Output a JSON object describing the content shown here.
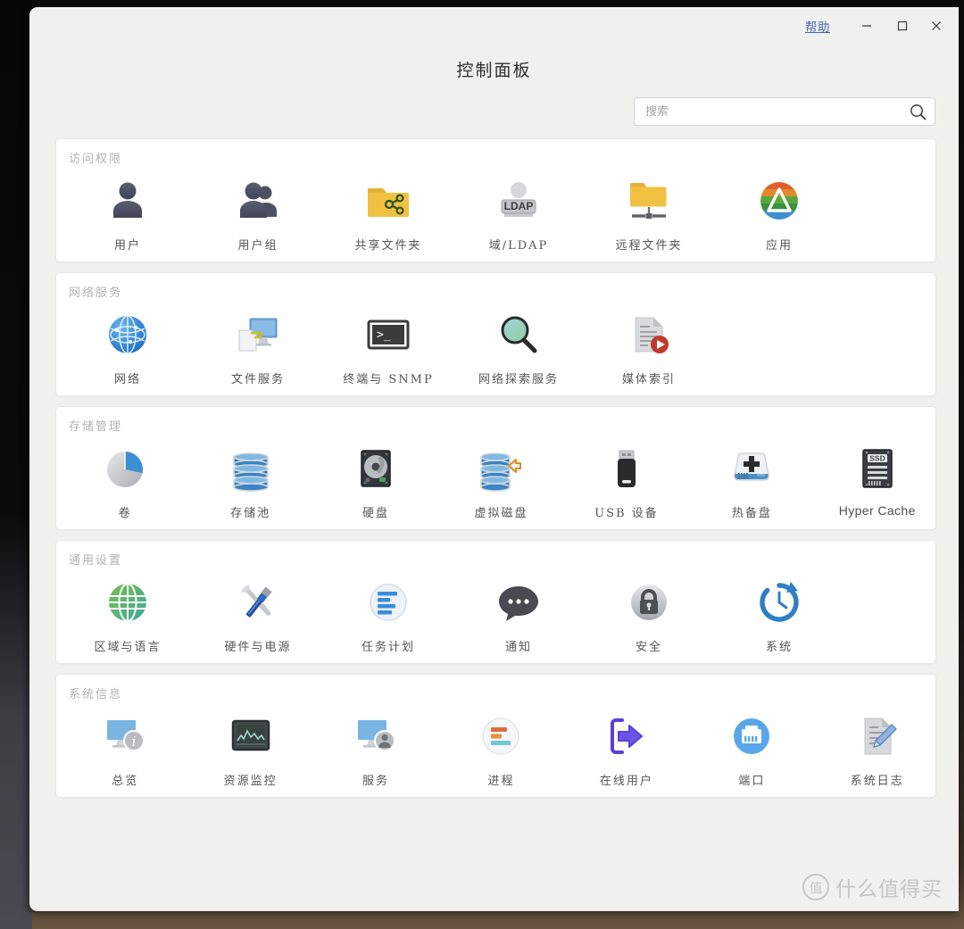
{
  "window": {
    "help_label": "帮助",
    "minimize_label": "minimize",
    "maximize_label": "maximize",
    "close_label": "close"
  },
  "page_title": "控制面板",
  "search": {
    "placeholder": "搜索",
    "value": "",
    "icon": "search-icon"
  },
  "watermark": {
    "logo_char": "值",
    "text": "什么值得买"
  },
  "colors": {
    "accent_blue": "#4a66b5",
    "folder_yellow": "#f2c44c",
    "window_bg": "#f0f0ef",
    "card_bg": "#ffffff",
    "section_title": "#b2b2b2",
    "label": "#555555"
  },
  "sections": [
    {
      "title": "访问权限",
      "items": [
        {
          "label": "用户",
          "icon": "user-icon"
        },
        {
          "label": "用户组",
          "icon": "user-group-icon"
        },
        {
          "label": "共享文件夹",
          "icon": "shared-folder-icon"
        },
        {
          "label": "域/LDAP",
          "icon": "ldap-icon",
          "badge": "LDAP"
        },
        {
          "label": "远程文件夹",
          "icon": "remote-folder-icon"
        },
        {
          "label": "应用",
          "icon": "app-icon"
        }
      ]
    },
    {
      "title": "网络服务",
      "items": [
        {
          "label": "网络",
          "icon": "globe-network-icon"
        },
        {
          "label": "文件服务",
          "icon": "file-service-icon"
        },
        {
          "label": "终端与 SNMP",
          "icon": "terminal-icon"
        },
        {
          "label": "网络探索服务",
          "icon": "network-discovery-icon"
        },
        {
          "label": "媒体索引",
          "icon": "media-index-icon"
        }
      ]
    },
    {
      "title": "存储管理",
      "items": [
        {
          "label": "卷",
          "icon": "volume-pie-icon"
        },
        {
          "label": "存储池",
          "icon": "storage-pool-icon"
        },
        {
          "label": "硬盘",
          "icon": "hard-disk-icon"
        },
        {
          "label": "虚拟磁盘",
          "icon": "virtual-disk-icon"
        },
        {
          "label": "USB 设备",
          "icon": "usb-device-icon"
        },
        {
          "label": "热备盘",
          "icon": "hot-spare-icon"
        },
        {
          "label": "Hyper Cache",
          "icon": "ssd-cache-icon",
          "latin": true
        }
      ]
    },
    {
      "title": "通用设置",
      "items": [
        {
          "label": "区域与语言",
          "icon": "region-language-icon"
        },
        {
          "label": "硬件与电源",
          "icon": "hardware-power-icon"
        },
        {
          "label": "任务计划",
          "icon": "task-scheduler-icon"
        },
        {
          "label": "通知",
          "icon": "notification-icon"
        },
        {
          "label": "安全",
          "icon": "security-lock-icon"
        },
        {
          "label": "系统",
          "icon": "system-clock-icon"
        }
      ]
    },
    {
      "title": "系统信息",
      "items": [
        {
          "label": "总览",
          "icon": "overview-icon"
        },
        {
          "label": "资源监控",
          "icon": "resource-monitor-icon"
        },
        {
          "label": "服务",
          "icon": "service-icon"
        },
        {
          "label": "进程",
          "icon": "process-icon"
        },
        {
          "label": "在线用户",
          "icon": "online-user-icon"
        },
        {
          "label": "端口",
          "icon": "port-icon"
        },
        {
          "label": "系统日志",
          "icon": "system-log-icon"
        }
      ]
    }
  ]
}
